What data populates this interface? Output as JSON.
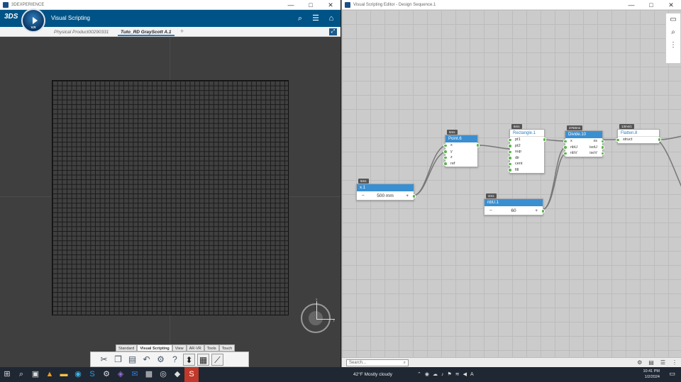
{
  "left": {
    "window_title": "3DEXPERIENCE",
    "app_title": "Visual Scripting",
    "compass_version": "V.R",
    "brand": "3DS",
    "tabs": [
      "Physical Product00290331",
      "Tuto_RD GrayScott A.1"
    ],
    "active_tab_index": 1,
    "tab_add": "+",
    "header_icons": [
      "search-icon",
      "menu-icon",
      "tag-icon"
    ],
    "gizmo_labels": {
      "x": "x",
      "y": "y"
    },
    "action_bar": {
      "tabs": [
        "Standard",
        "Visual Scripting",
        "View",
        "AR-VR",
        "Tools",
        "Touch"
      ],
      "active_tab": "Visual Scripting",
      "tools": [
        "cut-icon",
        "copy-icon",
        "paste-icon",
        "undo-icon",
        "settings-icon",
        "help-icon",
        "viewer-icon",
        "editor-icon",
        "graph-icon"
      ]
    }
  },
  "right": {
    "window_title": "Visual Scripting Editor - Design Sequence.1",
    "window_controls": [
      "—",
      "□",
      "✕"
    ],
    "nodes": {
      "x1": {
        "time": "5ms",
        "title": "x.1",
        "value": "500 mm",
        "minus": "−",
        "plus": "+"
      },
      "point": {
        "time": "5ms",
        "title": "Point.6",
        "ports": [
          "x",
          "y",
          "z",
          "ref"
        ]
      },
      "rectangle": {
        "time": "6ms",
        "title": "Rectangle.1",
        "ports": [
          "pt1",
          "pt2",
          "sup",
          "dir",
          "cent",
          "fill"
        ]
      },
      "nbu": {
        "time": "4ms",
        "title": "nbU.1",
        "value": "60",
        "minus": "−",
        "plus": "+"
      },
      "divide": {
        "time": "3750ms",
        "title": "Divide.10",
        "in_ports": [
          "x",
          "nbU",
          "nbV"
        ],
        "out_ports": [
          "xs",
          "isoU",
          "isoV"
        ]
      },
      "flatten": {
        "time": "13ms/1",
        "title": "Flatten.8",
        "ports": [
          "struct"
        ]
      }
    },
    "sidebar_icons": [
      "map-icon",
      "zoom-icon",
      "slider-icon"
    ],
    "search_placeholder": "Search...",
    "status_icons": [
      "settings-icon",
      "document-icon",
      "list-icon",
      "more-icon"
    ]
  },
  "taskbar": {
    "weather": "42°F  Mostly cloudy",
    "time": "10:41 PM",
    "date": "1/2/2024",
    "language": "A"
  }
}
